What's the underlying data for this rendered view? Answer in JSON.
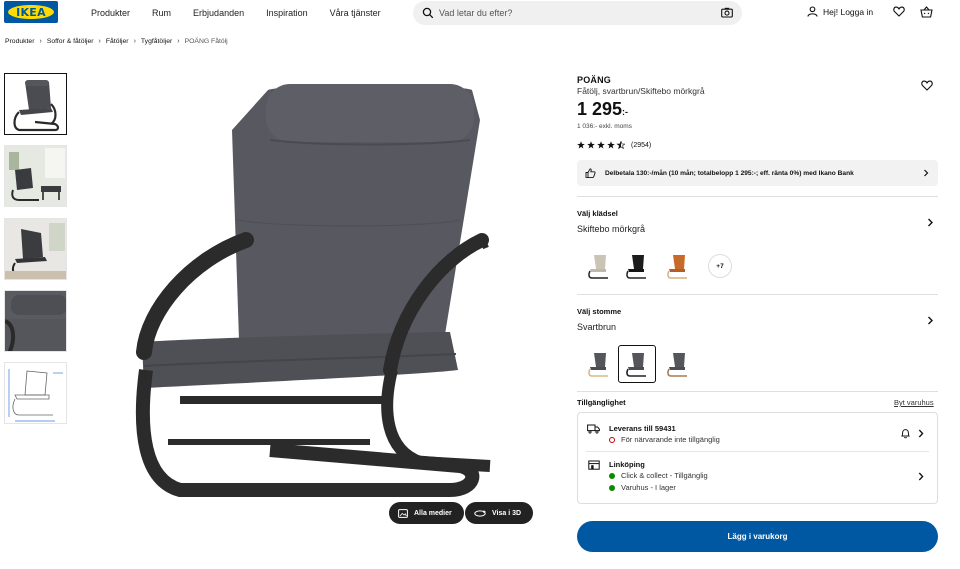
{
  "header": {
    "logo_text": "IKEA",
    "nav": [
      "Produkter",
      "Rum",
      "Erbjudanden",
      "Inspiration",
      "Våra tjänster"
    ],
    "search_placeholder": "Vad letar du efter?",
    "login_label": "Hej! Logga in"
  },
  "breadcrumb": [
    "Produkter",
    "Soffor & fåtöljer",
    "Fåtöljer",
    "Tygfåtöljer",
    "POÄNG Fåtölj"
  ],
  "gallery": {
    "thumbnail_count": 5,
    "active_index": 0,
    "all_media_label": "Alla medier",
    "view_3d_label": "Visa i 3D"
  },
  "product": {
    "name": "POÄNG",
    "description": "Fåtölj, svartbrun/Skiftebo mörkgrå",
    "price": "1 295",
    "price_suffix": ":-",
    "price_ex_vat": "1 036:- exkl. moms",
    "rating": 4.5,
    "review_count": "(2954)",
    "finance_text": "Delbetala 130:-/mån (10 mån; totalbelopp 1 295:-; eff. ränta 0%) med Ikano Bank"
  },
  "upholstery": {
    "label": "Välj klädsel",
    "value": "Skiftebo mörkgrå",
    "more_label": "+7"
  },
  "frame": {
    "label": "Välj stomme",
    "value": "Svartbrun",
    "selected_index": 1
  },
  "availability": {
    "title": "Tillgänglighet",
    "change_store": "Byt varuhus",
    "delivery_title": "Leverans till 59431",
    "delivery_status": "För närvarande inte tillgänglig",
    "store_title": "Linköping",
    "store_click_collect": "Click & collect - Tillgänglig",
    "store_stock": "Varuhus - I lager"
  },
  "cta": {
    "add_to_cart": "Lägg i varukorg"
  },
  "colors": {
    "brand_blue": "#0058a3",
    "brand_yellow": "#ffdb00",
    "available": "#0a8a00",
    "unavailable": "#cc0008"
  },
  "icons": [
    "search-icon",
    "camera-icon",
    "user-icon",
    "heart-icon",
    "cart-icon",
    "chevron-right-icon",
    "truck-icon",
    "store-icon",
    "bell-icon",
    "thumbs-up-icon",
    "media-icon",
    "3d-icon",
    "star-icon"
  ]
}
